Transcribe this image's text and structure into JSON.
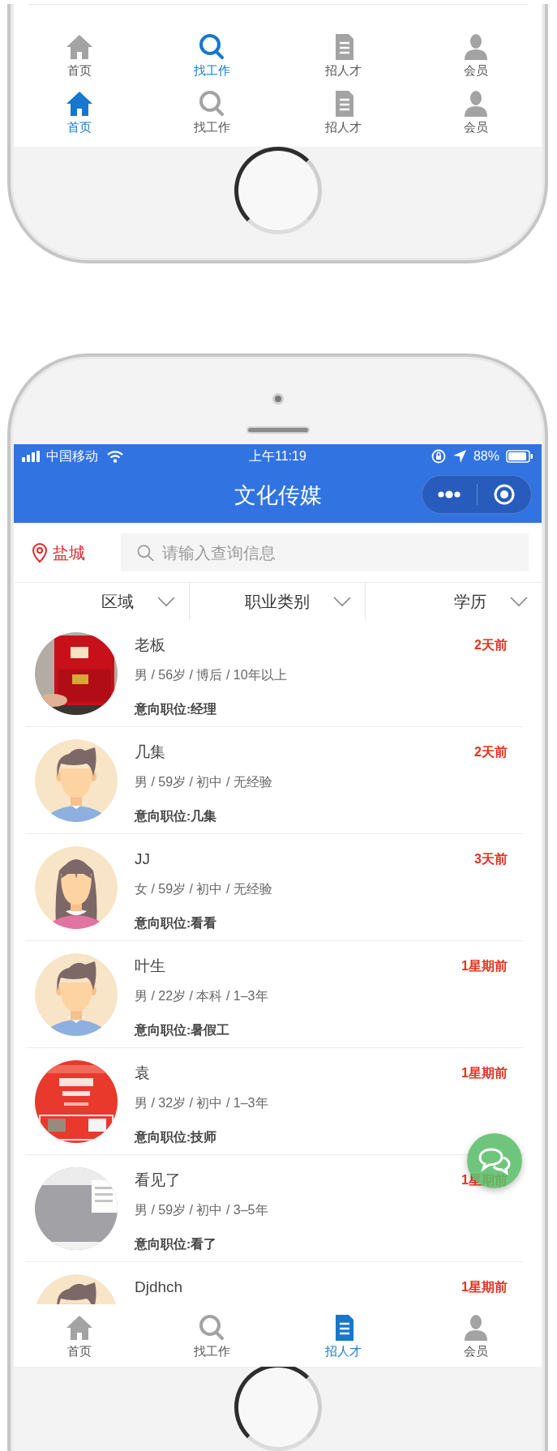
{
  "top_phone": {
    "tab_bars": [
      {
        "tabs": [
          {
            "label": "首页",
            "selected": false
          },
          {
            "label": "找工作",
            "selected": true
          },
          {
            "label": "招人才",
            "selected": false
          },
          {
            "label": "会员",
            "selected": false
          }
        ]
      },
      {
        "tabs": [
          {
            "label": "首页",
            "selected": true
          },
          {
            "label": "找工作",
            "selected": false
          },
          {
            "label": "招人才",
            "selected": false
          },
          {
            "label": "会员",
            "selected": false
          }
        ]
      }
    ]
  },
  "phone": {
    "status_bar": {
      "carrier": "中国移动",
      "time": "上午11:19",
      "battery": "88%"
    },
    "nav_bar": {
      "title": "文化传媒"
    },
    "search": {
      "location": "盐城",
      "placeholder": "请输入查询信息"
    },
    "filters": [
      {
        "label": "区域"
      },
      {
        "label": "职业类别"
      },
      {
        "label": "学历"
      }
    ],
    "candidates": [
      {
        "name": "老板",
        "details": "男 / 56岁 / 博后 / 10年以上",
        "position": "意向职位:经理",
        "posted": "2天前"
      },
      {
        "name": "几集",
        "avatar": {
          "kind": "male"
        },
        "details": "男 / 59岁 / 初中 / 无经验",
        "position": "意向职位:几集",
        "posted": "2天前"
      },
      {
        "name": "JJ",
        "avatar": {
          "kind": "female"
        },
        "details": "女 / 59岁 / 初中 / 无经验",
        "position": "意向职位:看看",
        "posted": "3天前"
      },
      {
        "name": "叶生",
        "avatar": {
          "kind": "male"
        },
        "details": "男 / 22岁 / 本科 / 1–3年",
        "position": "意向职位:暑假工",
        "posted": "1星期前"
      },
      {
        "name": "袁",
        "details": "男 / 32岁 / 初中 / 1–3年",
        "position": "意向职位:技师",
        "posted": "1星期前"
      },
      {
        "name": "看见了",
        "details": "男 / 59岁 / 初中 / 3–5年",
        "position": "意向职位:看了",
        "posted": "1星期前"
      },
      {
        "name": "Djdhch",
        "avatar": {
          "kind": "male"
        },
        "posted": "1星期前"
      }
    ],
    "tab_bar": {
      "tabs": [
        {
          "label": "首页",
          "selected": false
        },
        {
          "label": "找工作",
          "selected": false
        },
        {
          "label": "招人才",
          "selected": true
        },
        {
          "label": "会员",
          "selected": false
        }
      ]
    }
  }
}
